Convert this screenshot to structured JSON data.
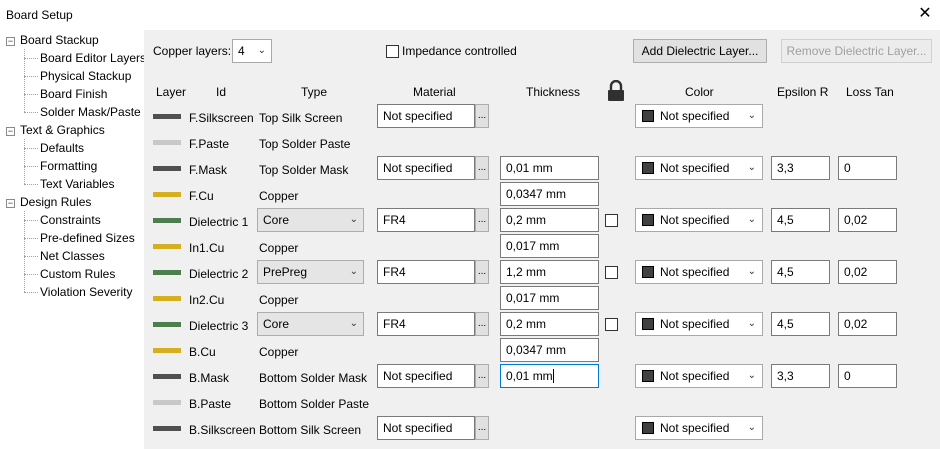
{
  "window": {
    "title": "Board Setup",
    "close_glyph": "✕"
  },
  "tree": {
    "groups": [
      {
        "label": "Board Stackup",
        "expander": "−",
        "items": [
          "Board Editor Layers",
          "Physical Stackup",
          "Board Finish",
          "Solder Mask/Paste"
        ]
      },
      {
        "label": "Text & Graphics",
        "expander": "−",
        "items": [
          "Defaults",
          "Formatting",
          "Text Variables"
        ]
      },
      {
        "label": "Design Rules",
        "expander": "−",
        "items": [
          "Constraints",
          "Pre-defined Sizes",
          "Net Classes",
          "Custom Rules",
          "Violation Severity"
        ]
      }
    ],
    "selected": "Physical Stackup"
  },
  "toolbar": {
    "copper_layers_label": "Copper layers:",
    "copper_layers_value": "4",
    "impedance_label": "Impedance controlled",
    "impedance_checked": false,
    "add_dielectric": "Add Dielectric Layer...",
    "remove_dielectric": "Remove Dielectric Layer..."
  },
  "columns": {
    "layer": "Layer",
    "id": "Id",
    "type": "Type",
    "material": "Material",
    "thickness": "Thickness",
    "lock": "lock-icon",
    "color": "Color",
    "epsilon": "Epsilon R",
    "loss": "Loss Tan"
  },
  "ellipsis": "...",
  "rows": [
    {
      "swatch": "#505050",
      "id": "F.Silkscreen",
      "type": "Top Silk Screen",
      "material": "Not specified",
      "thickness": "",
      "color": "Not specified",
      "epsilon": "",
      "loss": ""
    },
    {
      "swatch": "#c8c8c8",
      "id": "F.Paste",
      "type": "Top Solder Paste",
      "material": "",
      "thickness": "",
      "color": "",
      "epsilon": "",
      "loss": ""
    },
    {
      "swatch": "#505050",
      "id": "F.Mask",
      "type": "Top Solder Mask",
      "material": "Not specified",
      "thickness": "0,01 mm",
      "color": "Not specified",
      "epsilon": "3,3",
      "loss": "0"
    },
    {
      "swatch": "#d4b020",
      "id": "F.Cu",
      "type": "Copper",
      "material": "",
      "thickness": "0,0347 mm",
      "color": "",
      "epsilon": "",
      "loss": ""
    },
    {
      "swatch": "#4e7d4e",
      "id": "Dielectric 1",
      "type": "Core",
      "type_combo": true,
      "material": "FR4",
      "thickness": "0,2 mm",
      "lock": true,
      "color": "Not specified",
      "epsilon": "4,5",
      "loss": "0,02"
    },
    {
      "swatch": "#d4b020",
      "id": "In1.Cu",
      "type": "Copper",
      "material": "",
      "thickness": "0,017 mm",
      "color": "",
      "epsilon": "",
      "loss": ""
    },
    {
      "swatch": "#4e7d4e",
      "id": "Dielectric 2",
      "type": "PrePreg",
      "type_combo": true,
      "material": "FR4",
      "thickness": "1,2 mm",
      "lock": true,
      "color": "Not specified",
      "epsilon": "4,5",
      "loss": "0,02"
    },
    {
      "swatch": "#d4b020",
      "id": "In2.Cu",
      "type": "Copper",
      "material": "",
      "thickness": "0,017 mm",
      "color": "",
      "epsilon": "",
      "loss": ""
    },
    {
      "swatch": "#4e7d4e",
      "id": "Dielectric 3",
      "type": "Core",
      "type_combo": true,
      "material": "FR4",
      "thickness": "0,2 mm",
      "lock": true,
      "color": "Not specified",
      "epsilon": "4,5",
      "loss": "0,02"
    },
    {
      "swatch": "#d4b020",
      "id": "B.Cu",
      "type": "Copper",
      "material": "",
      "thickness": "0,0347 mm",
      "color": "",
      "epsilon": "",
      "loss": ""
    },
    {
      "swatch": "#505050",
      "id": "B.Mask",
      "type": "Bottom Solder Mask",
      "material": "Not specified",
      "thickness": "0,01 mm",
      "thickness_focused": true,
      "color": "Not specified",
      "epsilon": "3,3",
      "loss": "0"
    },
    {
      "swatch": "#c8c8c8",
      "id": "B.Paste",
      "type": "Bottom Solder Paste",
      "material": "",
      "thickness": "",
      "color": "",
      "epsilon": "",
      "loss": ""
    },
    {
      "swatch": "#505050",
      "id": "B.Silkscreen",
      "type": "Bottom Silk Screen",
      "material": "Not specified",
      "thickness": "",
      "color": "Not specified",
      "epsilon": "",
      "loss": ""
    }
  ]
}
